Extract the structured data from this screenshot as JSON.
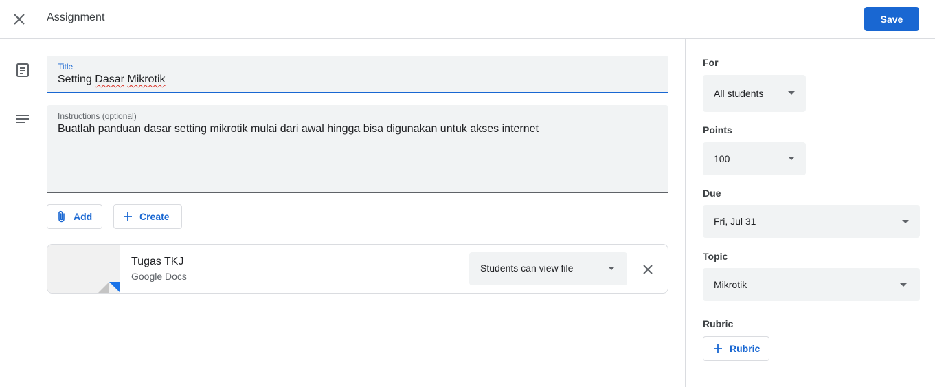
{
  "header": {
    "title": "Assignment",
    "save_label": "Save"
  },
  "form": {
    "title_label": "Title",
    "title_value": "Setting Dasar Mikrotik",
    "instructions_label": "Instructions (optional)",
    "instructions_value": "Buatlah panduan dasar setting mikrotik mulai dari awal hingga bisa digunakan untuk akses internet",
    "add_label": "Add",
    "create_label": "Create"
  },
  "attachment": {
    "name": "Tugas TKJ",
    "type": "Google Docs",
    "permission": "Students can view file"
  },
  "panel": {
    "for_label": "For",
    "for_value": "All students",
    "points_label": "Points",
    "points_value": "100",
    "due_label": "Due",
    "due_value": "Fri, Jul 31",
    "topic_label": "Topic",
    "topic_value": "Mikrotik",
    "rubric_label": "Rubric",
    "rubric_button": "Rubric"
  },
  "colors": {
    "accent": "#1967d2",
    "field_bg": "#f1f3f4",
    "border": "#dadce0"
  }
}
